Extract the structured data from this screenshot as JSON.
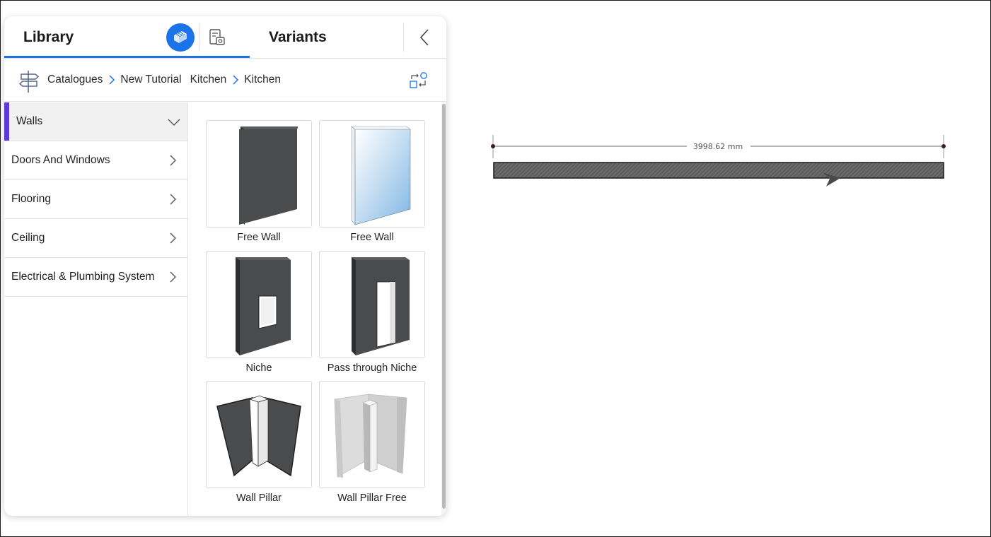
{
  "tabs": {
    "library": "Library",
    "variants": "Variants"
  },
  "breadcrumb": {
    "items": [
      "Catalogues",
      "New Tutorial",
      "Kitchen",
      "Kitchen"
    ]
  },
  "categories": [
    {
      "label": "Walls",
      "active": true
    },
    {
      "label": "Doors And Windows"
    },
    {
      "label": "Flooring"
    },
    {
      "label": "Ceiling"
    },
    {
      "label": "Electrical & Plumbing System"
    }
  ],
  "items": [
    {
      "label": "Free Wall"
    },
    {
      "label": "Free Wall"
    },
    {
      "label": "Niche"
    },
    {
      "label": "Pass through Niche"
    },
    {
      "label": "Wall Pillar"
    },
    {
      "label": "Wall Pillar Free"
    }
  ],
  "canvas": {
    "dimension": "3998.62 mm"
  },
  "colors": {
    "accent": "#1a73e8",
    "active_marker": "#5b3bd6",
    "wall_dark": "#4a4b4c"
  }
}
